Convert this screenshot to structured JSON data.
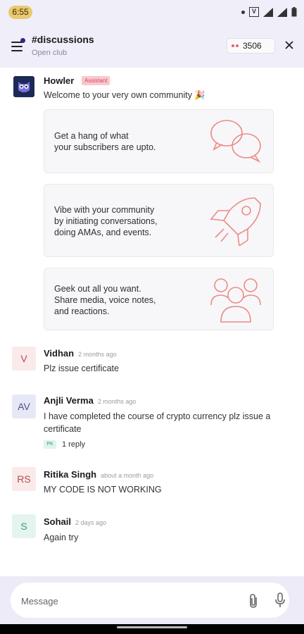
{
  "status_bar": {
    "time": "6:55"
  },
  "header": {
    "channel": "#discussions",
    "subtitle": "Open club",
    "points": "3506"
  },
  "bot_message": {
    "name": "Howler",
    "tag": "Assistant",
    "text": "Welcome to your very own community 🎉"
  },
  "cards": [
    {
      "text": "Get a hang of what\nyour subscribers are upto.",
      "icon": "chat-bubbles-icon"
    },
    {
      "text": "Vibe with your community\nby initiating conversations,\ndoing AMAs, and events.",
      "icon": "rocket-icon"
    },
    {
      "text": "Geek out all you want.\nShare media, voice notes,\nand reactions.",
      "icon": "group-icon"
    }
  ],
  "messages": [
    {
      "initials": "V",
      "name": "Vidhan",
      "time": "2 months ago",
      "text": "Plz issue certificate",
      "avatar_bg": "#fbeaea",
      "avatar_fg": "#b0504f"
    },
    {
      "initials": "AV",
      "name": "Anjli Verma",
      "time": "2 months ago",
      "text": "I have completed the course of crypto currency plz issue a certificate",
      "avatar_bg": "#e6e8f6",
      "avatar_fg": "#4c5488",
      "reply_initials": "PK",
      "reply_count": "1 reply"
    },
    {
      "initials": "RS",
      "name": "Ritika Singh",
      "time": "about a month ago",
      "text": "MY CODE IS NOT WORKING",
      "avatar_bg": "#fbeaea",
      "avatar_fg": "#b0504f"
    },
    {
      "initials": "S",
      "name": "Sohail",
      "time": "2 days ago",
      "text": "Again try",
      "avatar_bg": "#e3f5ee",
      "avatar_fg": "#3c9b6f"
    }
  ],
  "composer": {
    "placeholder": "Message"
  },
  "colors": {
    "accent": "#2d2a86",
    "brand_pink": "#e3627b",
    "header_bg": "#f0eef9"
  }
}
